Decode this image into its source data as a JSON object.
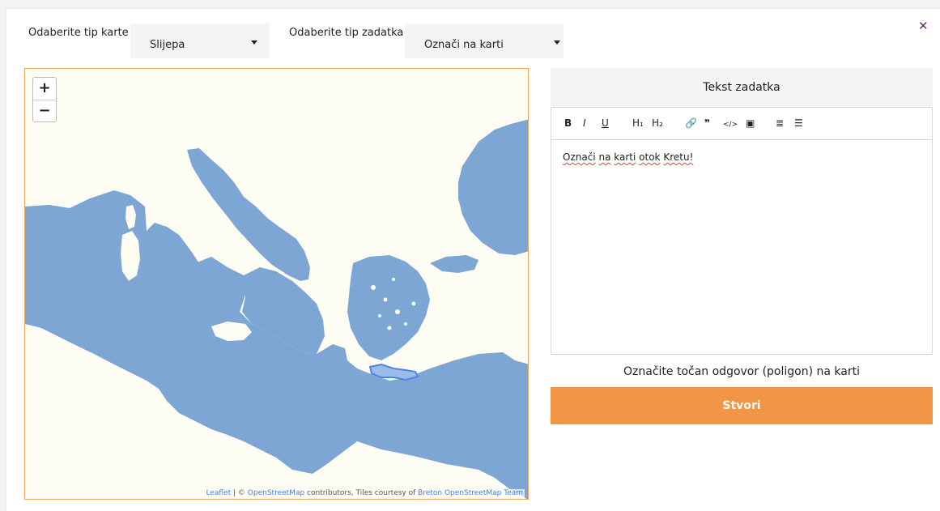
{
  "modal": {
    "close_icon": "close-icon"
  },
  "filters": {
    "map_type_label": "Odaberite tip karte",
    "map_type_value": "Slijepa",
    "task_type_label": "Odaberite tip zadatka",
    "task_type_value": "Označi na karti"
  },
  "map": {
    "zoom_in": "+",
    "zoom_out": "−",
    "attribution": {
      "leaflet": "Leaflet",
      "sep": " | © ",
      "osm": "OpenStreetMap",
      "mid": " contributors, Tiles courtesy of ",
      "breton": "Breton OpenStreetMap Team"
    },
    "colors": {
      "sea_land": "#fdfdf3",
      "water": "#7ea6d4",
      "selection": "#4a86e8"
    }
  },
  "editor": {
    "title": "Tekst zadatka",
    "toolbar": {
      "bold": "B",
      "italic": "I",
      "underline": "U",
      "h1": "H₁",
      "h2": "H₂",
      "link": "🔗",
      "quote": "❞",
      "code": "</>",
      "image": "▣",
      "ordered_list": "≣",
      "bullet_list": "☰"
    },
    "content_words": [
      "Označi",
      "na",
      "karti",
      "otok",
      "Kretu!"
    ]
  },
  "hint": "Označite točan odgovor (poligon) na karti",
  "create_button": "Stvori",
  "colors": {
    "accent": "#f29544",
    "close": "#6b2a6b",
    "map_border": "#f0a35b"
  }
}
